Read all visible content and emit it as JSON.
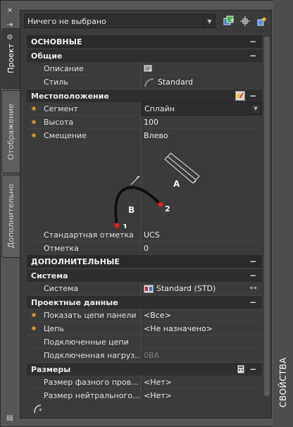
{
  "tabs": {
    "project": "Проект",
    "display": "Отображение",
    "extra": "Дополнительно"
  },
  "toolbar": {
    "selection_value": "Ничего не выбрано"
  },
  "palette_title": "СВОЙСТВА",
  "sections": {
    "basic": {
      "title": "ОСНОВНЫЕ",
      "general": {
        "title": "Общие",
        "description_label": "Описание",
        "style_label": "Стиль",
        "style_value": "Standard"
      },
      "location": {
        "title": "Местоположение",
        "segment_label": "Сегмент",
        "segment_value": "Сплайн",
        "height_label": "Высота",
        "height_value": "100",
        "offset_label": "Смещение",
        "offset_value": "Влево",
        "diagram": {
          "label_a": "A",
          "label_b": "B",
          "point_1": "1",
          "point_2": "2"
        },
        "std_mark_label": "Стандартная отметка",
        "std_mark_value": "UCS",
        "mark_label": "Отметка",
        "mark_value": "0"
      }
    },
    "additional": {
      "title": "ДОПОЛНИТЕЛЬНЫЕ",
      "system": {
        "title": "Система",
        "system_label": "Система",
        "system_value": "Standard (STD)"
      },
      "design_data": {
        "title": "Проектные данные",
        "show_circuits_label": "Показать цепи панели",
        "show_circuits_value": "<Все>",
        "circuit_label": "Цепь",
        "circuit_value": "<Не назначено>",
        "connected_circuits_label": "Подключенные цепи",
        "connected_circuits_value": "",
        "connected_load_label": "Подключенная нагруз...",
        "connected_load_value": "0ВА"
      },
      "sizes": {
        "title": "Размеры",
        "phase_size_label": "Размер фазного пров...",
        "phase_size_value": "<Нет>",
        "neutral_size_label": "Размер нейтрального...",
        "neutral_size_value": "<Нет>"
      }
    }
  },
  "colors": {
    "accent_point": "#e02020",
    "collapse_glyph": "−"
  }
}
